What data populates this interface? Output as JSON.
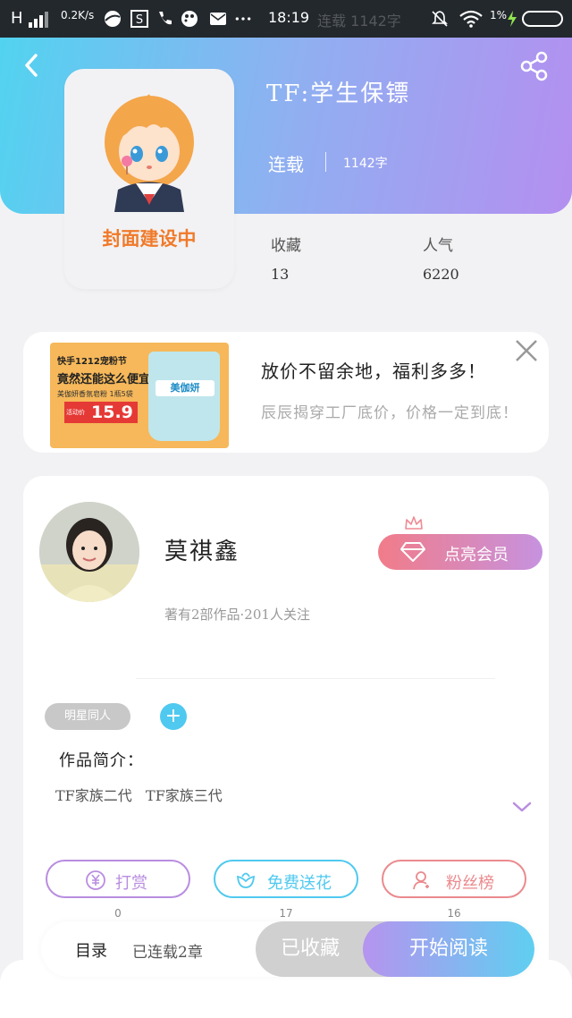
{
  "status_bar": {
    "network": "H",
    "speed": "0.2K/s",
    "time": "18:19",
    "ghost_text": "连载 1142字",
    "battery_pct": "1%",
    "icons": [
      "signal-icon",
      "browser-icon",
      "s-app-icon",
      "phone-icon",
      "palette-icon",
      "mail-icon",
      "more-icon",
      "mute-icon",
      "wifi-icon",
      "charging-icon",
      "battery-icon"
    ]
  },
  "header": {
    "back_icon": "back-icon",
    "share_icon": "share-icon",
    "cover_text": "封面建设中",
    "title": "TF:学生保镖",
    "status": "连载",
    "word_count": "1142字"
  },
  "stats": {
    "favorites_label": "收藏",
    "favorites_value": "13",
    "popularity_label": "人气",
    "popularity_value": "6220"
  },
  "ad": {
    "image_line1": "快手1212宠粉节",
    "image_line2": "竟然还能这么便宜",
    "image_line3": "美伽妍香氛皂粉 1瓶5袋",
    "image_price_tag": "活动价",
    "image_price": "15.9",
    "image_brand": "美伽妍",
    "title": "放价不留余地，福利多多！",
    "subtitle": "辰辰揭穿工厂底价，价格一定到底！",
    "close_icon": "close-icon"
  },
  "author": {
    "name": "莫祺鑫",
    "meta": "著有2部作品·201人关注",
    "vip_label": "点亮会员",
    "crown_icon": "crown-icon",
    "diamond_icon": "diamond-icon"
  },
  "tags": {
    "tag1": "明星同人",
    "add_symbol": "+"
  },
  "intro": {
    "label": "作品简介：",
    "text": "TF家族二代   TF家族三代",
    "expand_icon": "chevron-down-icon"
  },
  "actions": [
    {
      "label": "打赏",
      "count": "0",
      "color": "#b98de0",
      "icon": "yen-coin-icon"
    },
    {
      "label": "免费送花",
      "count": "17",
      "color": "#4fc9ef",
      "icon": "flower-icon"
    },
    {
      "label": "粉丝榜",
      "count": "16",
      "color": "#ea8a8e",
      "icon": "fans-icon"
    }
  ],
  "bottom_bar": {
    "toc_label": "目录",
    "toc_status": "已连载2章",
    "collected_label": "已收藏",
    "read_label": "开始阅读"
  },
  "colors": {
    "header_gradient": [
      "#52d3f0",
      "#b48ff0"
    ],
    "vip_gradient": [
      "#f17c89",
      "#c692df"
    ],
    "read_gradient": [
      "#b594ef",
      "#5fcff0"
    ],
    "cover_text": "#f07a2a"
  }
}
